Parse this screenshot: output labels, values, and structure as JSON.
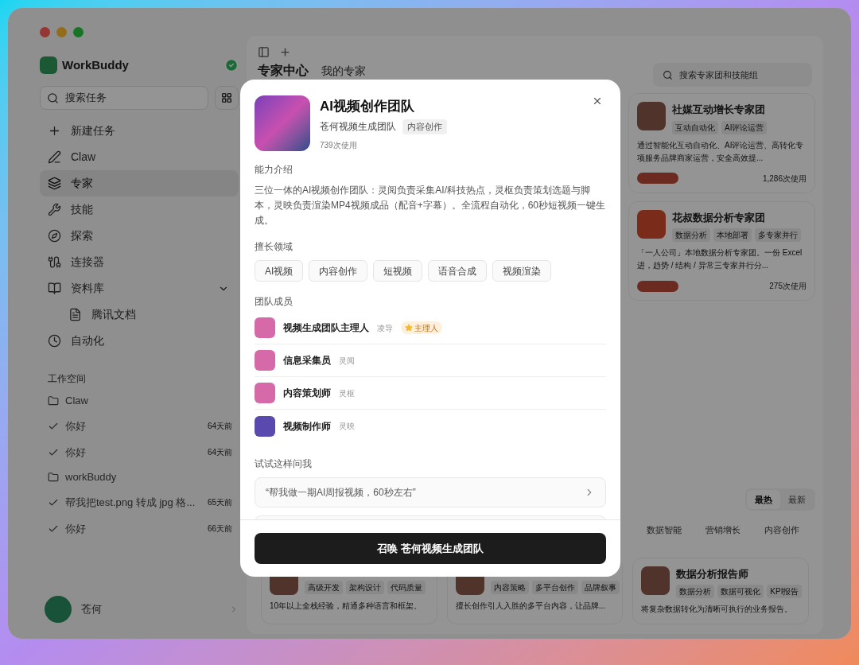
{
  "sidebar": {
    "app_name": "WorkBuddy",
    "search": {
      "placeholder": "搜索任务"
    },
    "nav": [
      {
        "label": "新建任务",
        "selected": false
      },
      {
        "label": "Claw",
        "selected": false
      },
      {
        "label": "专家",
        "selected": true
      },
      {
        "label": "技能",
        "selected": false
      },
      {
        "label": "探索",
        "selected": false
      },
      {
        "label": "连接器",
        "selected": false
      },
      {
        "label": "资料库",
        "selected": false,
        "expanded": true,
        "children": [
          {
            "label": "腾讯文档",
            "selected": false
          }
        ]
      },
      {
        "label": "自动化",
        "selected": false
      }
    ],
    "workspace": {
      "title": "工作空间",
      "folders": [
        {
          "name": "Claw",
          "tasks": [
            {
              "title": "你好",
              "time": "64天前"
            },
            {
              "title": "你好",
              "time": "64天前"
            }
          ]
        },
        {
          "name": "workBuddy",
          "tasks": [
            {
              "title": "帮我把test.png 转成 jpg 格...",
              "time": "65天前"
            },
            {
              "title": "你好",
              "time": "66天前"
            }
          ]
        }
      ]
    },
    "user": {
      "name": "苍何"
    }
  },
  "main": {
    "page_title": "专家中心",
    "tab": "我的专家",
    "search": {
      "placeholder": "搜索专家团和技能组"
    },
    "featured_cards": [
      {
        "title": "社媒互动增长专家团",
        "tags": [
          "互动自动化",
          "AI评论运营"
        ],
        "description": "通过智能化互动自动化、AI评论运营、高转化专项服务品牌商家运营，安全高效提...",
        "usage": "1,286次使用"
      },
      {
        "title": "花叔数据分析专家团",
        "tags": [
          "数据分析",
          "本地部署",
          "多专家并行"
        ],
        "description": "「一人公司」本地数据分析专家团。一份 Excel 进，趋势 / 结构 / 异常三专家并行分...",
        "usage": "275次使用"
      }
    ],
    "sort_options": [
      {
        "label": "最热",
        "selected": true
      },
      {
        "label": "最新",
        "selected": false
      }
    ],
    "categories": [
      {
        "label": "数据智能",
        "selected": false
      },
      {
        "label": "营销增长",
        "selected": false
      },
      {
        "label": "内容创作",
        "selected": false
      }
    ],
    "cards": [
      {
        "tags": [
          "高级开发",
          "架构设计",
          "代码质量"
        ],
        "description": "10年以上全栈经验，精通多种语言和框架。"
      },
      {
        "tags": [
          "内容策略",
          "多平台创作",
          "品牌叙事"
        ],
        "description": "擅长创作引人入胜的多平台内容，让品牌..."
      },
      {
        "title": "数据分析报告师",
        "tags": [
          "数据分析",
          "数据可视化",
          "KPI报告"
        ],
        "description": "将复杂数据转化为清晰可执行的业务报告。"
      }
    ]
  },
  "modal": {
    "title": "AI视频创作团队",
    "team": "苍何视频生成团队",
    "tag": "内容创作",
    "usage": "739次使用",
    "intro": {
      "heading": "能力介绍",
      "text": "三位一体的AI视频创作团队：灵阅负责采集AI/科技热点，灵枢负责策划选题与脚本，灵映负责渲染MP4视频成品（配音+字幕）。全流程自动化，60秒短视频一键生成。"
    },
    "domains": {
      "heading": "擅长领域",
      "items": [
        "AI视频",
        "内容创作",
        "短视频",
        "语音合成",
        "视频渲染"
      ]
    },
    "members": {
      "heading": "团队成员",
      "items": [
        {
          "name": "视频生成团队主理人",
          "alias": "凌导",
          "badge": "主理人"
        },
        {
          "name": "信息采集员",
          "alias": "灵阅"
        },
        {
          "name": "内容策划师",
          "alias": "灵枢"
        },
        {
          "name": "视频制作师",
          "alias": "灵映"
        }
      ]
    },
    "prompts": {
      "heading": "试试这样问我",
      "items": [
        "“帮我做一期AI周报视频，60秒左右”"
      ]
    },
    "action": "召唤 苍何视频生成团队"
  }
}
